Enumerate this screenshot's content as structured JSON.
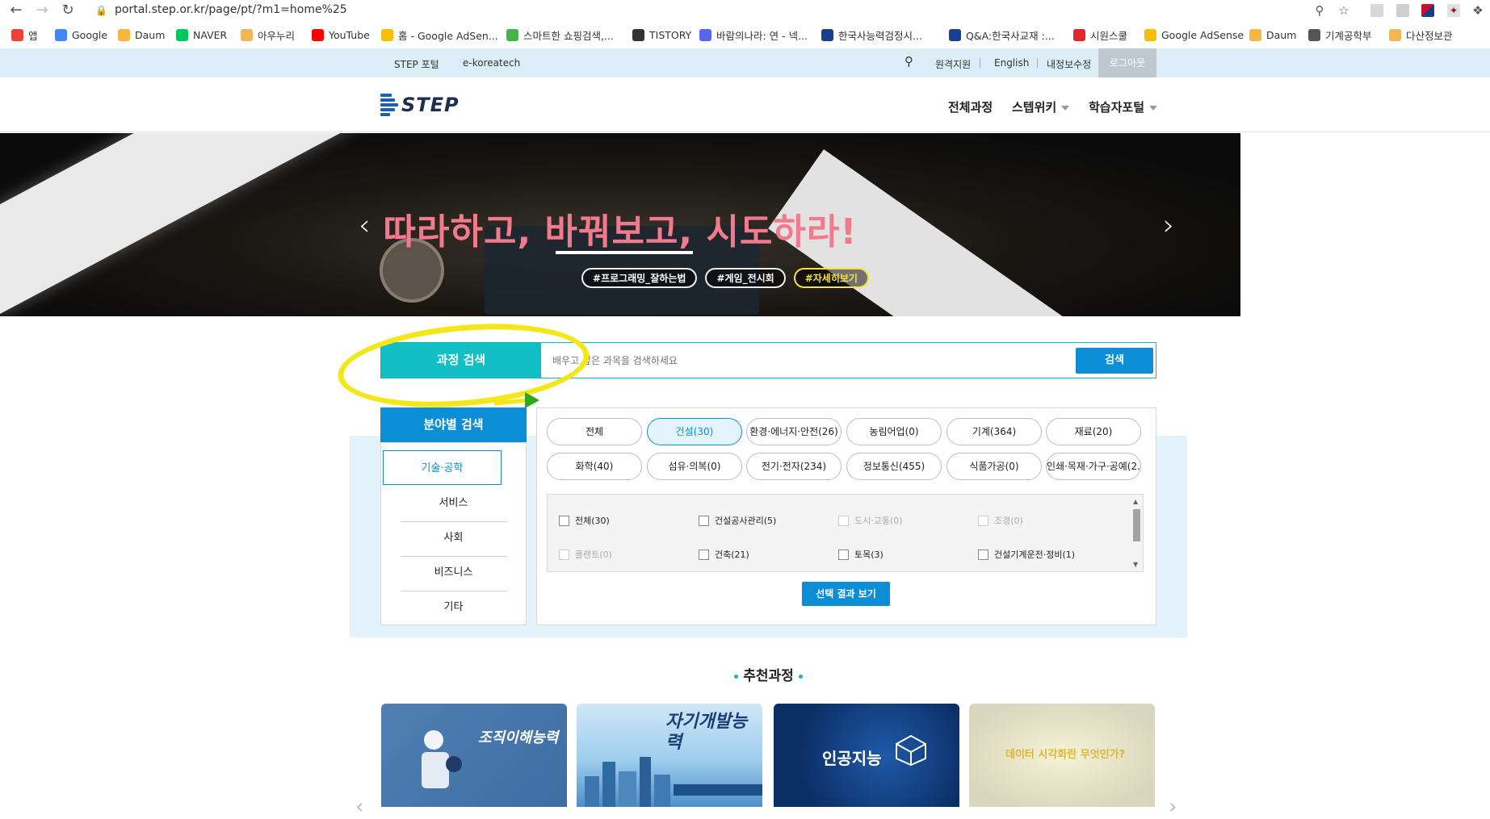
{
  "browser": {
    "url": "portal.step.or.kr/page/pt/?m1=home%25",
    "bookmarks": [
      {
        "label": "앱",
        "icon": "apps-grid-icon",
        "color": "#ea4335"
      },
      {
        "label": "Google",
        "icon": "google-icon",
        "color": "#4285f4"
      },
      {
        "label": "Daum",
        "icon": "daum-icon",
        "color": "#f8b63f"
      },
      {
        "label": "NAVER",
        "icon": "naver-icon",
        "color": "#03c75a"
      },
      {
        "label": "아우누리",
        "icon": "bookmark-icon",
        "color": "#f0b75a"
      },
      {
        "label": "YouTube",
        "icon": "youtube-icon",
        "color": "#ff0000"
      },
      {
        "label": "홈 - Google AdSen...",
        "icon": "adsense-icon",
        "color": "#fbbc05"
      },
      {
        "label": "스마트한 쇼핑검색,...",
        "icon": "danawa-icon",
        "color": "#3fb54a"
      },
      {
        "label": "TISTORY",
        "icon": "tistory-icon",
        "color": "#333333"
      },
      {
        "label": "바람의나라: 연 - 넥...",
        "icon": "discord-icon",
        "color": "#5865f2"
      },
      {
        "label": "한국사능력검정시...",
        "icon": "gsc-icon",
        "color": "#1a3e8c"
      },
      {
        "label": "Q&A:한국사교재 :...",
        "icon": "h-icon",
        "color": "#1b3f8f"
      },
      {
        "label": "시원스쿨",
        "icon": "s-icon",
        "color": "#e3262e"
      },
      {
        "label": "Google AdSense",
        "icon": "adsense-icon",
        "color": "#fbbc05"
      },
      {
        "label": "Daum",
        "icon": "daum-icon",
        "color": "#f8b63f"
      },
      {
        "label": "기계공학부",
        "icon": "globe-icon",
        "color": "#555555"
      },
      {
        "label": "다산정보관",
        "icon": "bookmark-icon",
        "color": "#f0b75a"
      }
    ]
  },
  "topbar": {
    "left_links": [
      "STEP 포털",
      "e-koreatech"
    ],
    "right_links": [
      "원격지원",
      "English",
      "내정보수정"
    ],
    "logout": "로그아웃"
  },
  "header": {
    "logo": "STEP",
    "nav": [
      "전체과정",
      "스텝위키",
      "학습자포털"
    ]
  },
  "banner": {
    "headline": "따라하고, 바꿔보고, 시도하라!",
    "tags": [
      "#프로그래밍_잘하는법",
      "#게임_전시회",
      "#자세히보기"
    ]
  },
  "search": {
    "label": "과정 검색",
    "placeholder": "배우고 싶은 과목을 검색하세요",
    "button": "검색"
  },
  "category": {
    "title": "분야별 검색",
    "sides": [
      "기술·공학",
      "서비스",
      "사회",
      "비즈니스",
      "기타"
    ],
    "chips": [
      "전체",
      "건설(30)",
      "환경·에너지·안전(26)",
      "농림어업(0)",
      "기계(364)",
      "재료(20)",
      "화학(40)",
      "섬유·의복(0)",
      "전기·전자(234)",
      "정보통신(455)",
      "식품가공(0)",
      "인쇄·목재·가구·공예(2..."
    ],
    "subitems": [
      {
        "label": "전체(30)",
        "enabled": true
      },
      {
        "label": "건설공사관리(5)",
        "enabled": true
      },
      {
        "label": "도시·교통(0)",
        "enabled": false
      },
      {
        "label": "조경(0)",
        "enabled": false
      },
      {
        "label": "플랜트(0)",
        "enabled": false
      },
      {
        "label": "건축(21)",
        "enabled": true
      },
      {
        "label": "토목(3)",
        "enabled": true
      },
      {
        "label": "건설기계운전·정비(1)",
        "enabled": true
      }
    ],
    "view_button": "선택 결과 보기"
  },
  "recommended": {
    "title": "추천과정",
    "cards": [
      {
        "caption": "조직이해능력"
      },
      {
        "caption": "자기개발능력"
      },
      {
        "caption": "인공지능"
      },
      {
        "caption": "데이터 시각화란 무엇인가?"
      }
    ]
  },
  "colors": {
    "accent_teal": "#12bfc4",
    "accent_blue": "#0b8ed6",
    "topbar_bg": "#dcedf8",
    "annotation_yellow": "#f3e71a"
  }
}
